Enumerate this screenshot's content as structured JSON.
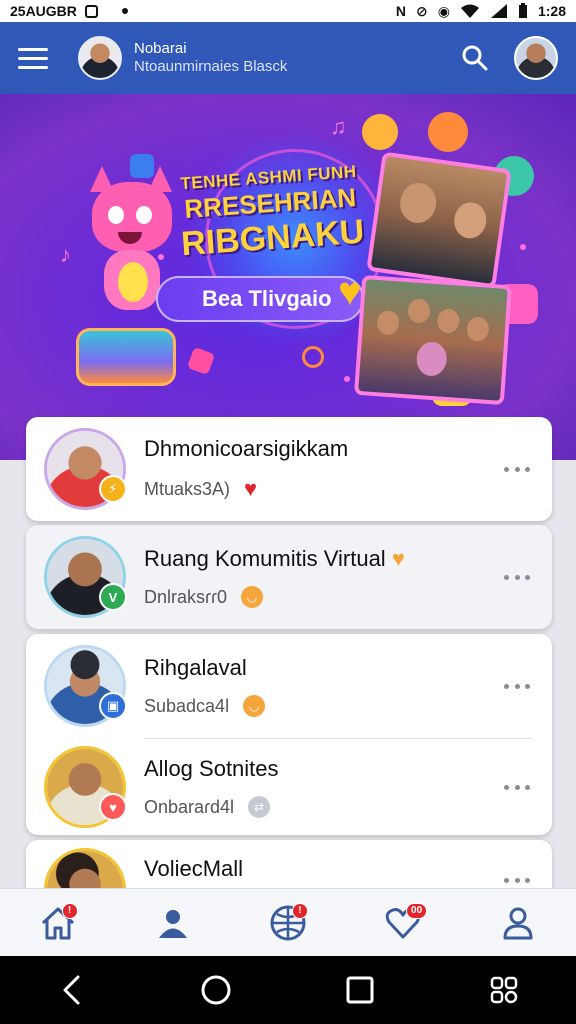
{
  "status_bar": {
    "left_text": "25AUGBR",
    "time": "1:28"
  },
  "app_bar": {
    "title": "Nobarai",
    "subtitle": "Ntoaunmirnaies Blasck",
    "menu_icon": "hamburger-icon",
    "search_icon": "search-icon",
    "profile_icon": "avatar"
  },
  "banner": {
    "headline_line1": "TENHE ASHMI FUNH",
    "headline_line2": "RRESEHRIAN",
    "headline_line3": "RIBGNAKU",
    "button_label": "Bea Tlivgaio",
    "colors": {
      "background": "#6a2bd8",
      "headline": "#ffd23c",
      "frame": "#ff7fe1"
    }
  },
  "communities": [
    {
      "name": "Dhmonicoarsigikkam",
      "subtitle": "Mtuaks3A)",
      "reaction": "heart-icon",
      "reaction_color": "#e2242b",
      "badge_icon": "lightning-icon",
      "badge_color": "#f5b21b",
      "avatar_ring": "#c9a8e8"
    },
    {
      "name": "Ruang Komumitis Virtual",
      "name_emoji": "heart-icon",
      "subtitle": "Dnlraksɾɾ0",
      "reaction": "smile-icon",
      "reaction_color": "#f4a63c",
      "badge_icon": "leaf-icon",
      "badge_color": "#2eaa54",
      "avatar_ring": "#8fd3e8"
    },
    {
      "name": "Rihgalaval",
      "subtitle": "Subadca4l",
      "reaction": "smile-icon",
      "reaction_color": "#f4a63c",
      "badge_icon": "briefcase-icon",
      "badge_color": "#2f6fd9",
      "avatar_ring": "#bcd9f2"
    },
    {
      "name": "Allog Sotnites",
      "subtitle": "Onbaraɾd4l",
      "reaction": "arrows-icon",
      "reaction_color": "#c6c9d1",
      "badge_icon": "heart-icon",
      "badge_color": "#ff5a5a",
      "avatar_ring": "#f2c531"
    },
    {
      "name": "VoliecMall",
      "subtitle": "",
      "reaction": "",
      "reaction_color": "",
      "badge_icon": "",
      "badge_color": "",
      "avatar_ring": "#f2c531"
    }
  ],
  "bottom_nav": [
    {
      "icon": "home-icon",
      "badge": "!"
    },
    {
      "icon": "people-icon",
      "badge": ""
    },
    {
      "icon": "globe-icon",
      "badge": "!"
    },
    {
      "icon": "heart-notification-icon",
      "badge": "00"
    },
    {
      "icon": "profile-icon",
      "badge": ""
    }
  ],
  "system_nav": [
    "back-icon",
    "home-circle-icon",
    "recents-icon",
    "accessibility-icon"
  ],
  "colors": {
    "app_bar": "#2f58b9",
    "card_bg": "#ffffff",
    "badge_red": "#e2242b"
  }
}
